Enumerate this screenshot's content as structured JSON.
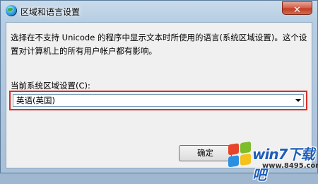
{
  "window": {
    "title": "区域和语言设置",
    "close_glyph": "✕"
  },
  "content": {
    "description": "选择在不支持 Unicode 的程序中显示文本时所使用的语言(系统区域设置)。这个设置对计算机上的所有用户帐户都有影响。",
    "current_label": "当前系统区域设置(C):",
    "locale_value": "英语(英国)"
  },
  "buttons": {
    "ok_label": "确定"
  },
  "watermark": {
    "title": "win7下载吧",
    "url": "www.8495.com"
  },
  "icons": {
    "window_icon": "globe-icon",
    "close": "close-icon",
    "dropdown": "chevron-down-icon"
  },
  "colors": {
    "highlight_border": "#d92b2b",
    "close_button": "#c13e24",
    "client_background": "#f0f0f0"
  }
}
